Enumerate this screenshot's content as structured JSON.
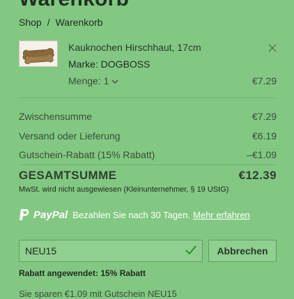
{
  "page": {
    "title": "Warenkorb"
  },
  "breadcrumb": {
    "shop": "Shop",
    "separator": "/",
    "current": "Warenkorb"
  },
  "item": {
    "name": "Kauknochen Hirschhaut, 17cm",
    "brand": "Marke: DOGBOSS",
    "quantity": "Menge: 1",
    "price": "€7.29",
    "image_icon": "dog-chew-bone"
  },
  "summary": {
    "subtotal_label": "Zwischensumme",
    "subtotal_value": "€7.29",
    "shipping_label": "Versand oder Lieferung",
    "shipping_value": "€6.19",
    "discount_label": "Gutschein-Rabatt (15% Rabatt)",
    "discount_value": "–€1.09",
    "total_label": "GESAMTSUMME",
    "total_value": "€12.39",
    "tax_note": "MwSt. wird nicht ausgewiesen (Kleinunternehmer, § 19 UStG)"
  },
  "paypal": {
    "brand": "PayPal",
    "text": "Bezahlen Sie nach 30 Tagen.",
    "link": "Mehr erfahren"
  },
  "coupon": {
    "value": "NEU15",
    "cancel_label": "Abbrechen",
    "applied_text": "Rabatt angewendet: 15% Rabatt"
  },
  "footer_partial": "Sie sparen €1.09 mit Gutschein NEU15",
  "colors": {
    "background": "#82c882",
    "check": "#2e8b2e",
    "text": "#1f2a1f"
  }
}
